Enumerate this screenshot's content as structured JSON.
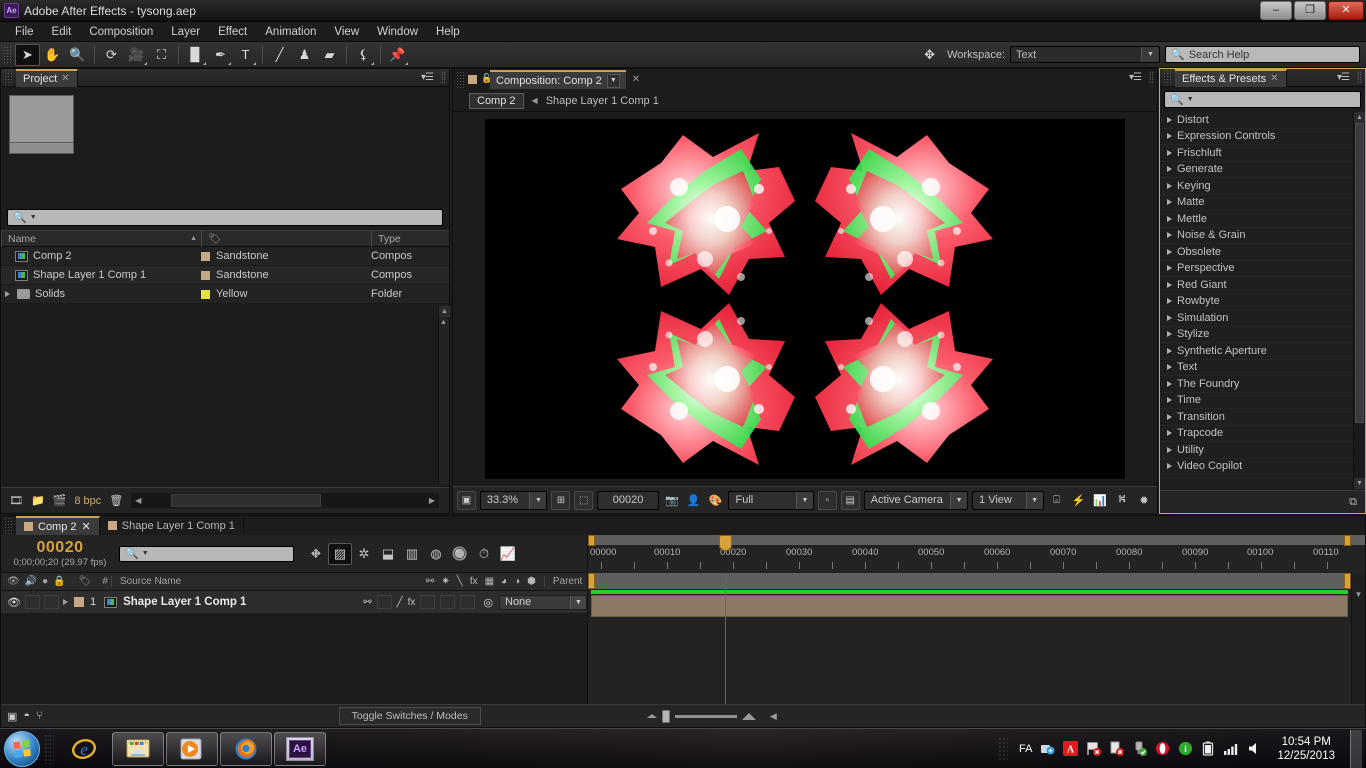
{
  "window": {
    "title": "Adobe After Effects - tysong.aep",
    "app_badge": "Ae",
    "minimize": "–",
    "restore": "❐",
    "close": "✕"
  },
  "menu": [
    "File",
    "Edit",
    "Composition",
    "Layer",
    "Effect",
    "Animation",
    "View",
    "Window",
    "Help"
  ],
  "toolbar": {
    "tools": [
      "selection-tool",
      "hand-tool",
      "zoom-tool",
      "rotation-tool",
      "camera-tool",
      "pan-behind-tool",
      "shape-tool",
      "pen-tool",
      "text-tool",
      "brush-tool",
      "clone-stamp-tool",
      "eraser-tool",
      "roto-brush-tool",
      "puppet-pin-tool"
    ],
    "workspace_label": "Workspace:",
    "workspace_value": "Text",
    "search_help_placeholder": "Search Help"
  },
  "project": {
    "tab": "Project",
    "search_placeholder": "",
    "columns": [
      "Name",
      "",
      "Type"
    ],
    "rows": [
      {
        "name": "Comp 2",
        "tag": "Sandstone",
        "tag_color": "#c8a882",
        "type": "Compos",
        "icon": "composition-icon"
      },
      {
        "name": "Shape Layer 1 Comp 1",
        "tag": "Sandstone",
        "tag_color": "#c8a882",
        "type": "Compos",
        "icon": "composition-icon"
      },
      {
        "name": "Solids",
        "tag": "Yellow",
        "tag_color": "#e8e13c",
        "type": "Folder",
        "icon": "folder-icon"
      }
    ],
    "bit_depth": "8 bpc"
  },
  "composition": {
    "tab_title": "Composition: Comp 2",
    "breadcrumb_active": "Comp 2",
    "breadcrumb_parent": "Shape Layer 1 Comp 1",
    "zoom": "33.3%",
    "timecode": "00020",
    "resolution": "Full",
    "camera": "Active Camera",
    "views": "1 View",
    "background": "#000000"
  },
  "effects_panel": {
    "tab": "Effects & Presets",
    "search_placeholder": "",
    "categories": [
      "Distort",
      "Expression Controls",
      "Frischluft",
      "Generate",
      "Keying",
      "Matte",
      "Mettle",
      "Noise & Grain",
      "Obsolete",
      "Perspective",
      "Red Giant",
      "Rowbyte",
      "Simulation",
      "Stylize",
      "Synthetic Aperture",
      "Text",
      "The Foundry",
      "Time",
      "Transition",
      "Trapcode",
      "Utility",
      "Video Copilot"
    ]
  },
  "timeline": {
    "tabs": [
      {
        "label": "Comp 2",
        "active": true,
        "color": "#c8a882"
      },
      {
        "label": "Shape Layer 1 Comp 1",
        "active": false,
        "color": "#c8a882"
      }
    ],
    "current_time_frames": "00020",
    "current_time_readout": "0;00;00;20 (29.97 fps)",
    "search_placeholder": "",
    "columns": [
      "Source Name",
      "Parent"
    ],
    "ruler_ticks": [
      "00000",
      "00010",
      "00020",
      "00030",
      "00040",
      "00050",
      "00060",
      "00070",
      "00080",
      "00090",
      "00100",
      "00110"
    ],
    "layers": [
      {
        "index": "1",
        "name": "Shape Layer 1 Comp 1",
        "label_color": "#c8a882",
        "parent": "None",
        "bar_color": "#8a7a63"
      }
    ],
    "toggle_button": "Toggle Switches / Modes"
  },
  "taskbar": {
    "apps": [
      "internet-explorer-icon",
      "windows-explorer-icon",
      "media-player-icon",
      "firefox-icon",
      "after-effects-icon"
    ],
    "ae_badge": "Ae",
    "language": "FA",
    "tray": [
      "network-sharing-icon",
      "adobe-updater-icon",
      "flag-error-icon",
      "document-error-icon",
      "usb-safely-remove-icon",
      "opera-icon",
      "info-icon",
      "battery-icon",
      "signal-icon",
      "volume-icon"
    ],
    "time": "10:54 PM",
    "date": "12/25/2013"
  }
}
